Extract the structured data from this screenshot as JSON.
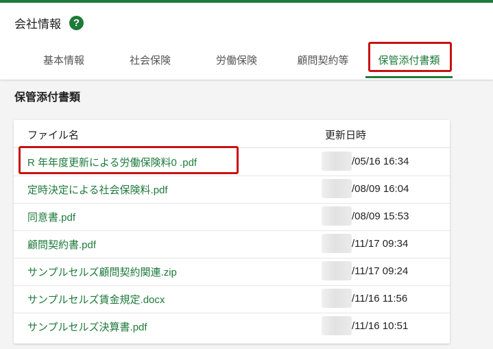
{
  "header": {
    "title": "会社情報",
    "help_icon": "?",
    "tabs": [
      {
        "label": "基本情報",
        "active": false
      },
      {
        "label": "社会保険",
        "active": false
      },
      {
        "label": "労働保険",
        "active": false
      },
      {
        "label": "顧問契約等",
        "active": false
      },
      {
        "label": "保管添付書類",
        "active": true
      }
    ]
  },
  "section": {
    "title": "保管添付書類"
  },
  "table": {
    "columns": [
      "ファイル名",
      "更新日時"
    ],
    "rows": [
      {
        "file": "R 年年度更新による労働保険料0   .pdf",
        "date": "/05/16 16:34"
      },
      {
        "file": "定時決定による社会保険料.pdf",
        "date": "/08/09 16:04"
      },
      {
        "file": "同意書.pdf",
        "date": "/08/09 15:53"
      },
      {
        "file": "顧問契約書.pdf",
        "date": "/11/17 09:34"
      },
      {
        "file": "サンプルセルズ顧問契約関連.zip",
        "date": "/11/17 09:24"
      },
      {
        "file": "サンプルセルズ賃金規定.docx",
        "date": "/11/16 11:56"
      },
      {
        "file": "サンプルセルズ決算書.pdf",
        "date": "/11/16 10:51"
      }
    ]
  },
  "colors": {
    "accent": "#1e7a3a",
    "highlight": "#c81010"
  }
}
